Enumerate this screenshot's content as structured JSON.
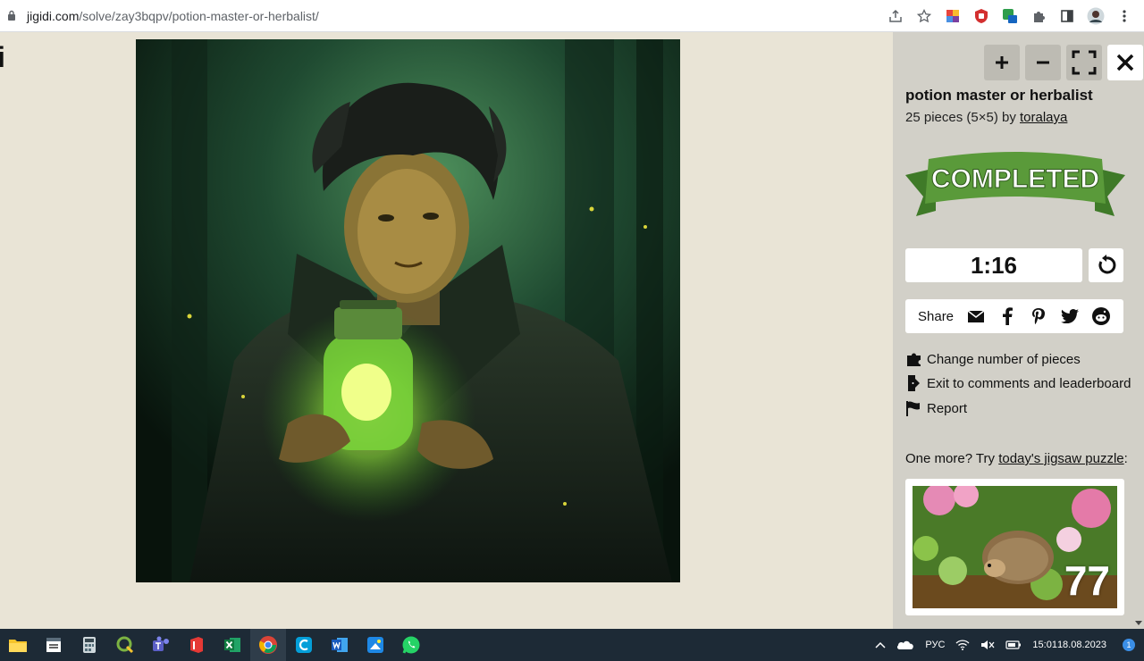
{
  "browser": {
    "url_host": "jigidi.com",
    "url_path": "/solve/zay3bqpv/potion-master-or-herbalist/"
  },
  "page": {
    "cut_letter": "i"
  },
  "sidebar": {
    "title": "potion master or herbalist",
    "meta_prefix": "25 pieces (5×5) by ",
    "author": "toralaya",
    "ribbon_text": "COMPLETED",
    "timer": "1:16",
    "share_label": "Share",
    "links": [
      {
        "label": "Change number of pieces",
        "icon": "puzzle-piece-icon"
      },
      {
        "label": "Exit to comments and leaderboard",
        "icon": "exit-door-icon"
      },
      {
        "label": "Report",
        "icon": "flag-icon"
      }
    ],
    "onemore_prefix": "One more? Try ",
    "onemore_link": "today's jigsaw puzzle",
    "onemore_suffix": ":",
    "thumb_count": "77"
  },
  "taskbar": {
    "lang": "РУС",
    "time": "15:01",
    "date": "18.08.2023",
    "notifications": "1"
  },
  "colors": {
    "page_bg": "#e9e4d6",
    "sidebar_bg": "#d2d0c8",
    "ribbon_green": "#5a9a3a",
    "taskbar_bg": "#1d2a36"
  }
}
